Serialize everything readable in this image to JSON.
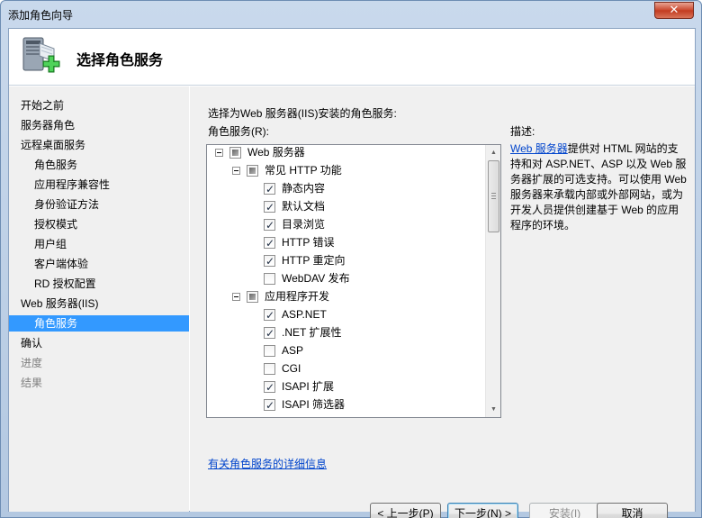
{
  "window": {
    "title": "添加角色向导",
    "close_glyph": "✕"
  },
  "header": {
    "title": "选择角色服务",
    "icon": "server-add-icon"
  },
  "nav": {
    "items": [
      {
        "label": "开始之前",
        "state": "normal",
        "level": 0
      },
      {
        "label": "服务器角色",
        "state": "normal",
        "level": 0
      },
      {
        "label": "远程桌面服务",
        "state": "normal",
        "level": 0
      },
      {
        "label": "角色服务",
        "state": "normal",
        "level": 1
      },
      {
        "label": "应用程序兼容性",
        "state": "normal",
        "level": 1
      },
      {
        "label": "身份验证方法",
        "state": "normal",
        "level": 1
      },
      {
        "label": "授权模式",
        "state": "normal",
        "level": 1
      },
      {
        "label": "用户组",
        "state": "normal",
        "level": 1
      },
      {
        "label": "客户端体验",
        "state": "normal",
        "level": 1
      },
      {
        "label": "RD 授权配置",
        "state": "normal",
        "level": 1
      },
      {
        "label": "Web 服务器(IIS)",
        "state": "normal",
        "level": 0
      },
      {
        "label": "角色服务",
        "state": "selected",
        "level": 1
      },
      {
        "label": "确认",
        "state": "normal",
        "level": 0
      },
      {
        "label": "进度",
        "state": "disabled",
        "level": 0
      },
      {
        "label": "结果",
        "state": "disabled",
        "level": 0
      }
    ]
  },
  "main": {
    "intro": "选择为Web 服务器(IIS)安装的角色服务:",
    "list_label": "角色服务(R):",
    "description_label": "描述:",
    "description_link": "Web 服务器",
    "description_text": "提供对 HTML 网站的支持和对 ASP.NET、ASP 以及 Web 服务器扩展的可选支持。可以使用 Web 服务器来承载内部或外部网站，或为开发人员提供创建基于 Web 的应用程序的环境。",
    "more_info_link": "有关角色服务的详细信息"
  },
  "tree": {
    "items": [
      {
        "label": "Web 服务器",
        "level": 0,
        "state": "partial",
        "expander": true
      },
      {
        "label": "常见 HTTP 功能",
        "level": 1,
        "state": "partial",
        "expander": true
      },
      {
        "label": "静态内容",
        "level": 2,
        "state": "checked",
        "expander": false
      },
      {
        "label": "默认文档",
        "level": 2,
        "state": "checked",
        "expander": false
      },
      {
        "label": "目录浏览",
        "level": 2,
        "state": "checked",
        "expander": false
      },
      {
        "label": "HTTP 错误",
        "level": 2,
        "state": "checked",
        "expander": false
      },
      {
        "label": "HTTP 重定向",
        "level": 2,
        "state": "checked",
        "expander": false
      },
      {
        "label": "WebDAV 发布",
        "level": 2,
        "state": "unchecked",
        "expander": false
      },
      {
        "label": "应用程序开发",
        "level": 1,
        "state": "partial",
        "expander": true
      },
      {
        "label": "ASP.NET",
        "level": 2,
        "state": "checked",
        "expander": false
      },
      {
        "label": ".NET 扩展性",
        "level": 2,
        "state": "checked",
        "expander": false
      },
      {
        "label": "ASP",
        "level": 2,
        "state": "unchecked",
        "expander": false
      },
      {
        "label": "CGI",
        "level": 2,
        "state": "unchecked",
        "expander": false
      },
      {
        "label": "ISAPI 扩展",
        "level": 2,
        "state": "checked",
        "expander": false
      },
      {
        "label": "ISAPI 筛选器",
        "level": 2,
        "state": "checked",
        "expander": false
      }
    ]
  },
  "buttons": {
    "back": "< 上一步(P)",
    "next": "下一步(N) >",
    "install": "安装(I)",
    "cancel": "取消"
  }
}
